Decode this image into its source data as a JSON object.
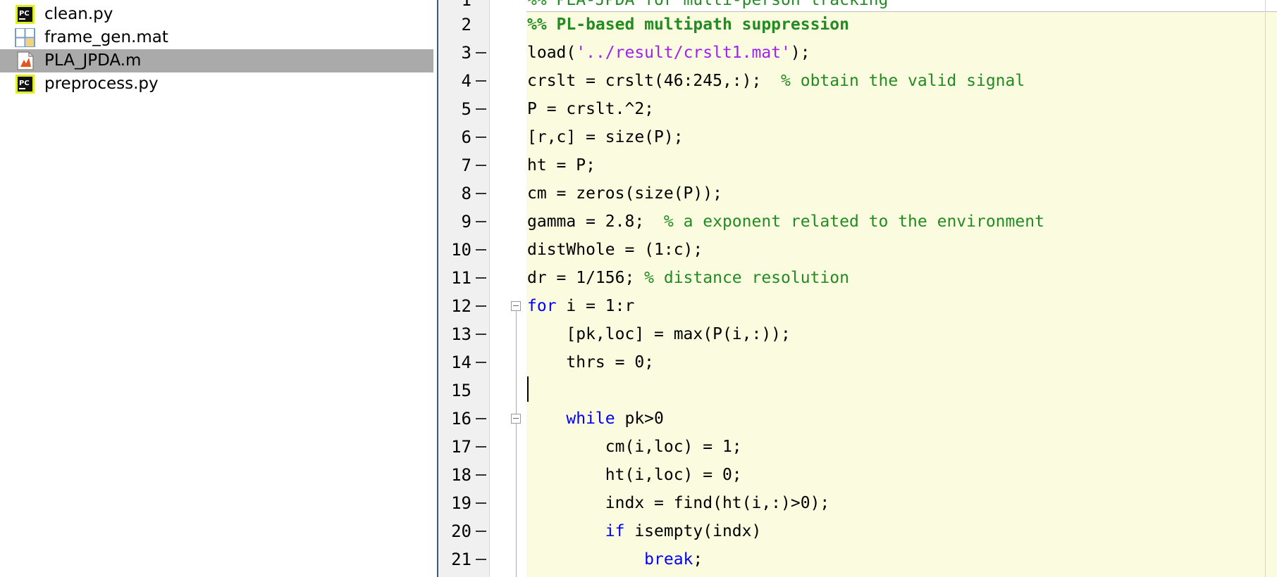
{
  "file_browser": {
    "items": [
      {
        "name": "clean.py",
        "icon": "pycharm-file-icon",
        "selected": false
      },
      {
        "name": "frame_gen.mat",
        "icon": "mat-file-icon",
        "selected": false
      },
      {
        "name": "PLA_JPDA.m",
        "icon": "matlab-file-icon",
        "selected": true
      },
      {
        "name": "preprocess.py",
        "icon": "pycharm-file-icon",
        "selected": false
      }
    ]
  },
  "editor": {
    "partial_top_line": "%% PLA-JPDA for multi-person tracking",
    "lines": [
      {
        "num": "2",
        "executable": false,
        "segments": [
          {
            "t": "%% PL-based multipath suppression",
            "c": "cell-title"
          }
        ]
      },
      {
        "num": "3",
        "executable": true,
        "segments": [
          {
            "t": "load(",
            "c": ""
          },
          {
            "t": "'../result/crslt1.mat'",
            "c": "str"
          },
          {
            "t": ");",
            "c": ""
          }
        ]
      },
      {
        "num": "4",
        "executable": true,
        "segments": [
          {
            "t": "crslt = crslt(46:245,:);  ",
            "c": ""
          },
          {
            "t": "% obtain the valid signal",
            "c": "cmt"
          }
        ]
      },
      {
        "num": "5",
        "executable": true,
        "segments": [
          {
            "t": "P = crslt.^2;",
            "c": ""
          }
        ]
      },
      {
        "num": "6",
        "executable": true,
        "segments": [
          {
            "t": "[r,c] = size(P);",
            "c": ""
          }
        ]
      },
      {
        "num": "7",
        "executable": true,
        "segments": [
          {
            "t": "ht = P;",
            "c": ""
          }
        ]
      },
      {
        "num": "8",
        "executable": true,
        "segments": [
          {
            "t": "cm = zeros(size(P));",
            "c": ""
          }
        ]
      },
      {
        "num": "9",
        "executable": true,
        "segments": [
          {
            "t": "gamma = 2.8;  ",
            "c": ""
          },
          {
            "t": "% a exponent related to the environment",
            "c": "cmt"
          }
        ]
      },
      {
        "num": "10",
        "executable": true,
        "segments": [
          {
            "t": "distWhole = (1:c);",
            "c": ""
          }
        ]
      },
      {
        "num": "11",
        "executable": true,
        "segments": [
          {
            "t": "dr = 1/156; ",
            "c": ""
          },
          {
            "t": "% distance resolution",
            "c": "cmt"
          }
        ]
      },
      {
        "num": "12",
        "executable": true,
        "segments": [
          {
            "t": "for",
            "c": "kw"
          },
          {
            "t": " i = 1:r",
            "c": ""
          }
        ]
      },
      {
        "num": "13",
        "executable": true,
        "segments": [
          {
            "t": "    [pk,loc] = max(P(i,:));",
            "c": ""
          }
        ]
      },
      {
        "num": "14",
        "executable": true,
        "segments": [
          {
            "t": "    thrs = 0;",
            "c": ""
          }
        ]
      },
      {
        "num": "15",
        "executable": false,
        "segments": [
          {
            "t": "",
            "c": ""
          }
        ]
      },
      {
        "num": "16",
        "executable": true,
        "segments": [
          {
            "t": "    ",
            "c": ""
          },
          {
            "t": "while",
            "c": "kw"
          },
          {
            "t": " pk>0",
            "c": ""
          }
        ]
      },
      {
        "num": "17",
        "executable": true,
        "segments": [
          {
            "t": "        cm(i,loc) = 1;",
            "c": ""
          }
        ]
      },
      {
        "num": "18",
        "executable": true,
        "segments": [
          {
            "t": "        ht(i,loc) = 0;",
            "c": ""
          }
        ]
      },
      {
        "num": "19",
        "executable": true,
        "segments": [
          {
            "t": "        indx = find(ht(i,:)>0);",
            "c": ""
          }
        ]
      },
      {
        "num": "20",
        "executable": true,
        "segments": [
          {
            "t": "        ",
            "c": ""
          },
          {
            "t": "if",
            "c": "kw"
          },
          {
            "t": " isempty(indx)",
            "c": ""
          }
        ]
      },
      {
        "num": "21",
        "executable": true,
        "segments": [
          {
            "t": "            ",
            "c": ""
          },
          {
            "t": "break",
            "c": "kw"
          },
          {
            "t": ";",
            "c": ""
          }
        ]
      }
    ]
  },
  "colors": {
    "keyword": "#0000ff",
    "string": "#a020f0",
    "comment": "#228b22",
    "cell_background": "#fbfbdf",
    "selection": "#aaaaaa"
  }
}
